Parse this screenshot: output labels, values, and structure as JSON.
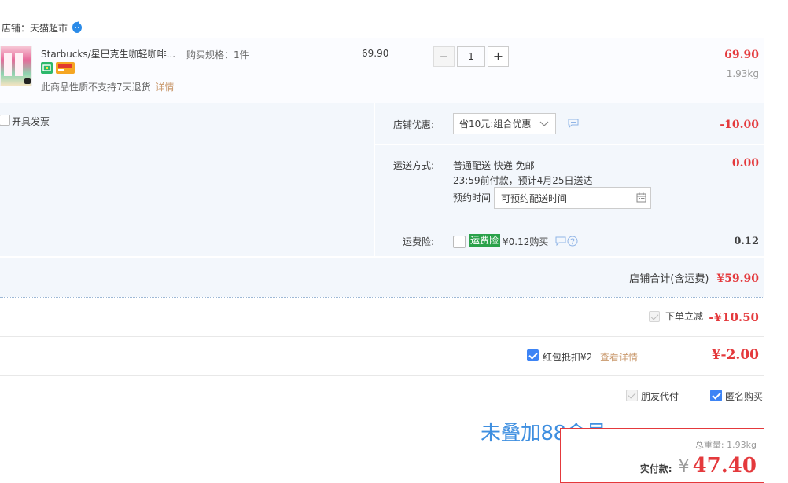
{
  "shop": {
    "label": "店铺：天猫超市"
  },
  "item": {
    "title": "Starbucks/星巴克生咖轻咖啡...",
    "spec": "购买规格：1件",
    "unit_price": "69.90",
    "quantity": "1",
    "minus": "−",
    "plus": "+",
    "total": "69.90",
    "weight": "1.93kg",
    "notice": "此商品性质不支持7天退货",
    "detail_link": "详情"
  },
  "invoice": {
    "label": "开具发票"
  },
  "discount": {
    "label": "店铺优惠:",
    "selected": "省10元:组合优惠",
    "value": "-10.00"
  },
  "shipping": {
    "label": "运送方式:",
    "line1": "普通配送 快递 免邮",
    "line2": "23:59前付款，预计4月25日送达",
    "appt_label": "预约时间",
    "appt_value": "可预约配送时间",
    "value": "0.00"
  },
  "insurance": {
    "label": "运费险:",
    "badge": "运费险",
    "text": "¥0.12购买",
    "value": "0.12"
  },
  "subtotal": {
    "label": "店铺合计(含运费)",
    "value": "¥59.90"
  },
  "instant_discount": {
    "label": "下单立减",
    "value": "-¥10.50"
  },
  "red_packet": {
    "label": "红包抵扣¥2",
    "link": "查看详情",
    "value": "¥-2.00"
  },
  "options": {
    "friend_pay": "朋友代付",
    "anonymous": "匿名购买"
  },
  "watermark": "未叠加88会员",
  "summary": {
    "weight_label": "总重量: 1.93kg",
    "pay_label": "实付款:",
    "currency": "¥",
    "amount": "47.40"
  },
  "colors": {
    "accent_red": "#e4393c",
    "blue_panel": "#f3f7fc",
    "checkbox_blue": "#3d84f5",
    "badge_green": "#2aa14a",
    "watermark_blue": "#3f8fe0"
  }
}
